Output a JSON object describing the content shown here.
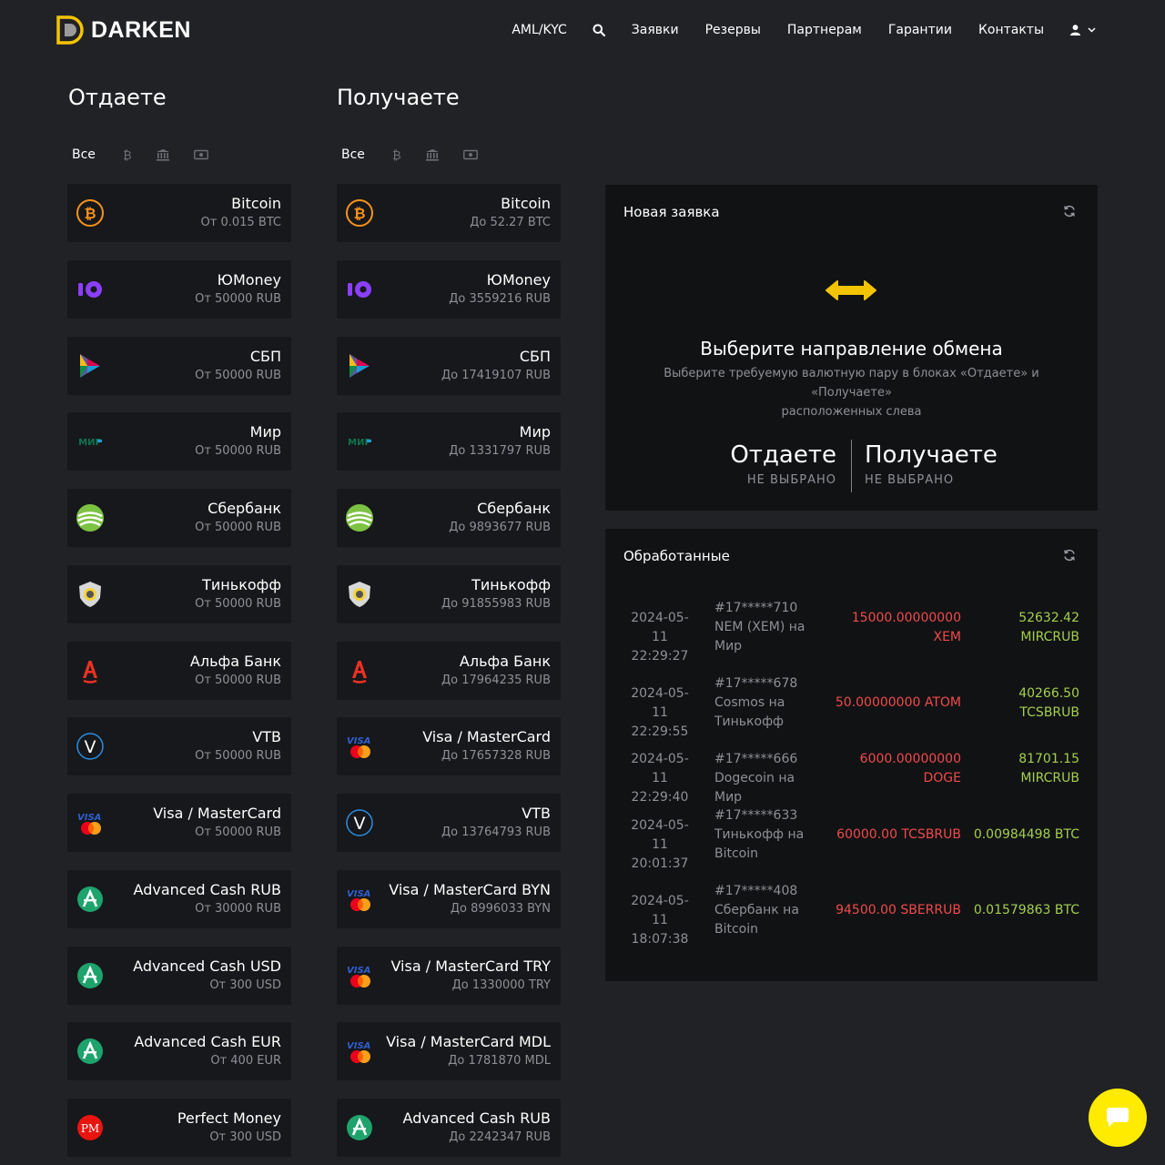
{
  "header": {
    "logo_text": "DARKEN",
    "nav": [
      "AML/KYC",
      "Заявки",
      "Резервы",
      "Партнерам",
      "Гарантии",
      "Контакты"
    ]
  },
  "give": {
    "title": "Отдаете",
    "filter_all": "Все",
    "items": [
      {
        "name": "Bitcoin",
        "limit": "От 0.015 BTC",
        "icon": "bitcoin-icon"
      },
      {
        "name": "ЮMoney",
        "limit": "От 50000 RUB",
        "icon": "yoomoney-icon"
      },
      {
        "name": "СБП",
        "limit": "От 50000 RUB",
        "icon": "sbp-icon"
      },
      {
        "name": "Мир",
        "limit": "От 50000 RUB",
        "icon": "mir-icon"
      },
      {
        "name": "Сбербанк",
        "limit": "От 50000 RUB",
        "icon": "sberbank-icon"
      },
      {
        "name": "Тинькофф",
        "limit": "От 50000 RUB",
        "icon": "tinkoff-icon"
      },
      {
        "name": "Альфа Банк",
        "limit": "От 50000 RUB",
        "icon": "alfabank-icon"
      },
      {
        "name": "VTB",
        "limit": "От 50000 RUB",
        "icon": "vtb-icon"
      },
      {
        "name": "Visa / MasterCard",
        "limit": "От 50000 RUB",
        "icon": "visa-mastercard-icon"
      },
      {
        "name": "Advanced Cash RUB",
        "limit": "От 30000 RUB",
        "icon": "advcash-icon"
      },
      {
        "name": "Advanced Cash USD",
        "limit": "От 300 USD",
        "icon": "advcash-icon"
      },
      {
        "name": "Advanced Cash EUR",
        "limit": "От 400 EUR",
        "icon": "advcash-icon"
      },
      {
        "name": "Perfect Money",
        "limit": "От 300 USD",
        "icon": "perfect-money-icon"
      }
    ]
  },
  "get": {
    "title": "Получаете",
    "filter_all": "Все",
    "items": [
      {
        "name": "Bitcoin",
        "limit": "До 52.27 BTC",
        "icon": "bitcoin-icon"
      },
      {
        "name": "ЮMoney",
        "limit": "До 3559216 RUB",
        "icon": "yoomoney-icon"
      },
      {
        "name": "СБП",
        "limit": "До 17419107 RUB",
        "icon": "sbp-icon"
      },
      {
        "name": "Мир",
        "limit": "До 1331797 RUB",
        "icon": "mir-icon"
      },
      {
        "name": "Сбербанк",
        "limit": "До 9893677 RUB",
        "icon": "sberbank-icon"
      },
      {
        "name": "Тинькофф",
        "limit": "До 91855983 RUB",
        "icon": "tinkoff-icon"
      },
      {
        "name": "Альфа Банк",
        "limit": "До 17964235 RUB",
        "icon": "alfabank-icon"
      },
      {
        "name": "Visa / MasterCard",
        "limit": "До 17657328 RUB",
        "icon": "visa-mastercard-icon"
      },
      {
        "name": "VTB",
        "limit": "До 13764793 RUB",
        "icon": "vtb-icon"
      },
      {
        "name": "Visa / MasterCard BYN",
        "limit": "До 8996033 BYN",
        "icon": "visa-mastercard-icon"
      },
      {
        "name": "Visa / MasterCard TRY",
        "limit": "До 1330000 TRY",
        "icon": "visa-mastercard-icon"
      },
      {
        "name": "Visa / MasterCard MDL",
        "limit": "До 1781870 MDL",
        "icon": "visa-mastercard-icon"
      },
      {
        "name": "Advanced Cash RUB",
        "limit": "До 2242347 RUB",
        "icon": "advcash-icon"
      }
    ]
  },
  "new_order": {
    "title": "Новая заявка",
    "heading": "Выберите направление обмена",
    "subtitle_line1": "Выберите требуемую валютную пару в блоках «Отдаете» и «Получаете»",
    "subtitle_line2": "расположенных слева",
    "give_label": "Отдаете",
    "give_value": "НЕ ВЫБРАНО",
    "get_label": "Получаете",
    "get_value": "НЕ ВЫБРАНО"
  },
  "processed": {
    "title": "Обработанные",
    "orders": [
      {
        "date": "2024-05-11",
        "time": "22:29:27",
        "desc": [
          "#17*****710",
          "NEM (XEM) на",
          "Мир"
        ],
        "give": [
          "15000.00000000",
          "XEM"
        ],
        "get": [
          "52632.42",
          "MIRCRUB"
        ]
      },
      {
        "date": "2024-05-11",
        "time": "22:29:55",
        "desc": [
          "#17*****678",
          "Cosmos на",
          "Тинькофф"
        ],
        "give": [
          "50.00000000 ATOM"
        ],
        "get": [
          "40266.50",
          "TCSBRUB"
        ]
      },
      {
        "date": "2024-05-11",
        "time": "22:29:40",
        "desc": [
          "#17*****666",
          "Dogecoin на Мир"
        ],
        "give": [
          "6000.00000000",
          "DOGE"
        ],
        "get": [
          "81701.15",
          "MIRCRUB"
        ]
      },
      {
        "date": "2024-05-11",
        "time": "20:01:37",
        "desc": [
          "#17*****633",
          "Тинькофф на",
          "Bitcoin"
        ],
        "give": [
          "60000.00 TCSBRUB"
        ],
        "get": [
          "0.00984498 BTC"
        ]
      },
      {
        "date": "2024-05-11",
        "time": "18:07:38",
        "desc": [
          "#17*****408",
          "Сбербанк на",
          "Bitcoin"
        ],
        "give": [
          "94500.00 SBERRUB"
        ],
        "get": [
          "0.01579863 BTC"
        ]
      }
    ]
  },
  "colors": {
    "accent": "#f5c400",
    "give": "#ef4b4b",
    "get": "#a3cf4e",
    "chat": "#ffeb00"
  }
}
